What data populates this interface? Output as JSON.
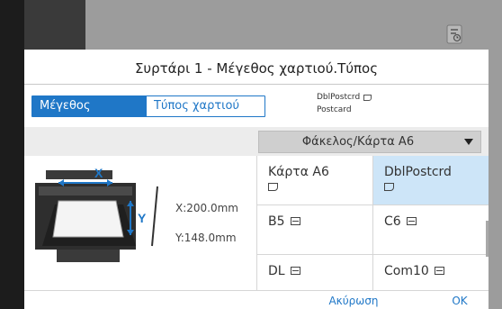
{
  "dialog": {
    "title": "Συρτάρι 1 - Μέγεθος χαρτιού.Τύπος",
    "tabs": [
      {
        "label": "Μέγεθος χαρτιού",
        "active": true
      },
      {
        "label": "Τύπος χαρτιού",
        "active": false
      }
    ],
    "paper_info": {
      "line1": "DblPostcrd",
      "line2": "Postcard"
    },
    "selected_category": "Φάκελος/Κάρτα Α6",
    "dimensions": {
      "x": "X:200.0mm",
      "y": "Y:148.0mm"
    },
    "sizes": [
      {
        "label": "Κάρτα Α6",
        "icon": "postcard-icon",
        "selected": false
      },
      {
        "label": "DblPostcrd",
        "icon": "postcard-icon",
        "selected": true
      },
      {
        "label": "B5",
        "icon": "envelope-icon",
        "selected": false
      },
      {
        "label": "C6",
        "icon": "envelope-icon",
        "selected": false
      },
      {
        "label": "DL",
        "icon": "envelope-icon",
        "selected": false
      },
      {
        "label": "Com10",
        "icon": "envelope-icon",
        "selected": false
      }
    ],
    "cancel_label": "Ακύρωση",
    "ok_label": "OK"
  },
  "colors": {
    "accent": "#1f77c7",
    "selected_cell": "#cde5f8"
  }
}
